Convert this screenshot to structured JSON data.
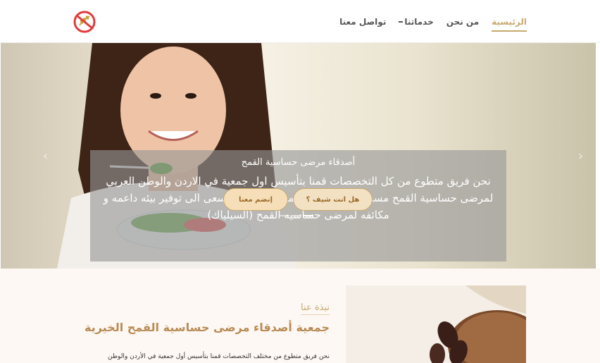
{
  "nav": {
    "items": [
      {
        "label": "الرئيسية",
        "active": true
      },
      {
        "label": "من نحن",
        "active": false
      },
      {
        "label": "خدماتنا",
        "active": false,
        "has_dropdown": true
      },
      {
        "label": "تواصل معنا",
        "active": false
      }
    ]
  },
  "hero": {
    "title": "أصدقاء مرضى حساسية القمح",
    "text": "نحن فريق متطوع من كل التخصصات قمنا بتأسيس اول جمعية في الاردن والوطن العربي لمرضى حساسية القمح مسجلة لدى وزارة التنمية الاجتماعية نسعى الى توفير بيئه داعمه و مكائفه لمرضى حساسيه القمح (السيلياك)",
    "btn_chef": "هل انت شيف ؟",
    "btn_join": "إنضم معنا",
    "slides": 3,
    "active_slide": 3
  },
  "about": {
    "subtitle": "نبذة عنا",
    "title": "جمعية أصدقاء مرضى حساسية القمح الخيرية",
    "body": "نحن فريق متطوع من مختلف التخصصات قمنا بتأسيس أول جمعية في الأردن والوطن"
  },
  "colors": {
    "accent": "#c8a96e",
    "title_brown": "#b98b55",
    "logo_red": "#e23b3b"
  },
  "icons": {
    "logo": "no-wheat-logo-icon",
    "dropdown": "dropdown-icon",
    "prev": "chevron-left-icon",
    "next": "chevron-right-icon"
  }
}
